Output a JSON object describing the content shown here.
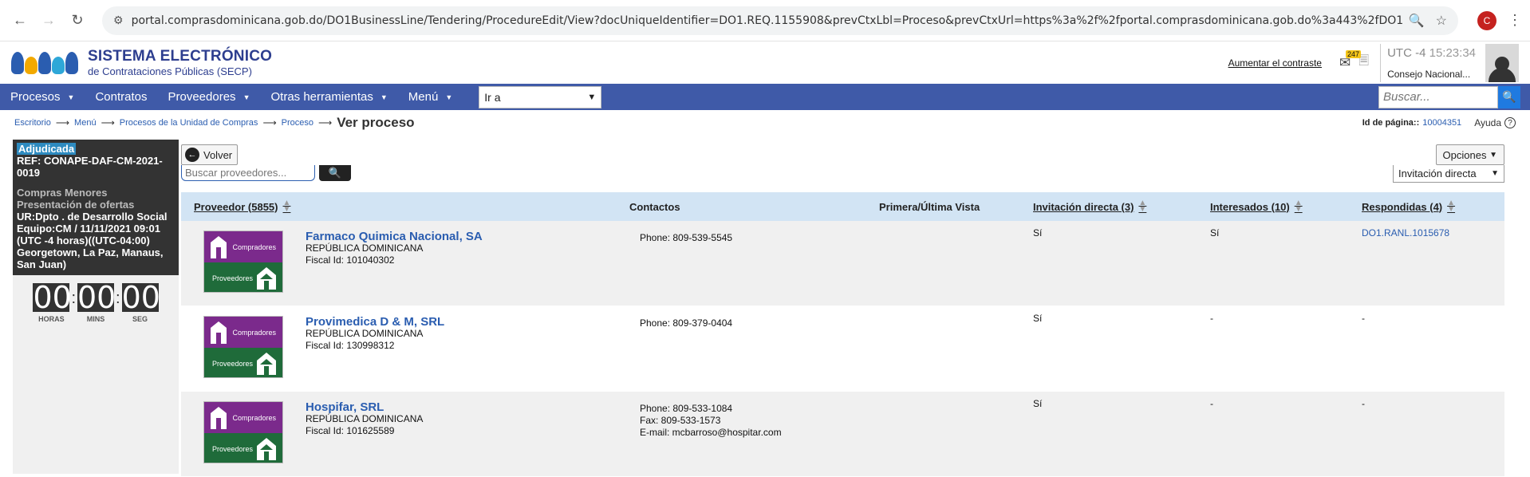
{
  "browser": {
    "url": "portal.comprasdominicana.gob.do/DO1BusinessLine/Tendering/ProcedureEdit/View?docUniqueIdentifier=DO1.REQ.1155908&prevCtxLbl=Proceso&prevCtxUrl=https%3a%2f%2fportal.comprasdominicana.gob.do%3a443%2fDO1BusinessLine%2fTendering%2f...",
    "profile_initial": "C"
  },
  "header": {
    "brand_title": "SISTEMA ELECTRÓNICO",
    "brand_sub": "de Contrataciones Públicas (SECP)",
    "contrast_link": "Aumentar el contraste",
    "mail_count": "247",
    "timezone": "UTC -4",
    "time": "15:23:34",
    "org": "Consejo Nacional..."
  },
  "nav": {
    "items": [
      "Procesos",
      "Contratos",
      "Proveedores",
      "Otras herramientas",
      "Menú"
    ],
    "goto_value": "Ir a",
    "search_placeholder": "Buscar..."
  },
  "breadcrumb": {
    "items": [
      "Escritorio",
      "Menú",
      "Procesos de la Unidad de Compras",
      "Proceso"
    ],
    "current": "Ver proceso",
    "page_id_label": "Id de página::",
    "page_id": "10004351",
    "help": "Ayuda"
  },
  "process": {
    "status": "Adjudicada",
    "ref": "REF: CONAPE-DAF-CM-2021-0019",
    "type": "Compras Menores",
    "phase": "Presentación de ofertas",
    "details": "UR:Dpto . de Desarrollo Social Equipo:CM / 11/11/2021 09:01 (UTC -4 horas)((UTC-04:00) Georgetown, La Paz, Manaus, San Juan)"
  },
  "timer": {
    "hours": "00",
    "mins": "00",
    "secs": "00",
    "hours_label": "HORAS",
    "mins_label": "MINS",
    "secs_label": "SEG"
  },
  "actions": {
    "back": "Volver",
    "options": "Opciones",
    "provider_search_placeholder": "Buscar proveedores...",
    "filter": "Invitación directa"
  },
  "table": {
    "headers": {
      "proveedor": "Proveedor (5855)",
      "contactos": "Contactos",
      "vista": "Primera/Última Vista",
      "invitacion": "Invitación directa (3)",
      "interesados": "Interesados (10)",
      "respondidas": "Respondidas (4)"
    },
    "logo_top": "Compradores",
    "logo_bottom": "Proveedores",
    "rows": [
      {
        "name": "Farmaco Quimica Nacional, SA",
        "country": "REPÚBLICA DOMINICANA",
        "fiscal": "Fiscal Id: 101040302",
        "contact1": "Phone: 809-539-5545",
        "contact2": "",
        "contact3": "",
        "invitacion": "Sí",
        "interesados": "Sí",
        "respondidas": "DO1.RANL.1015678"
      },
      {
        "name": "Provimedica D & M, SRL",
        "country": "REPÚBLICA DOMINICANA",
        "fiscal": "Fiscal Id: 130998312",
        "contact1": "Phone: 809-379-0404",
        "contact2": "",
        "contact3": "",
        "invitacion": "Sí",
        "interesados": "-",
        "respondidas": "-"
      },
      {
        "name": "Hospifar, SRL",
        "country": "REPÚBLICA DOMINICANA",
        "fiscal": "Fiscal Id: 101625589",
        "contact1": "Phone: 809-533-1084",
        "contact2": "Fax: 809-533-1573",
        "contact3": "E-mail: mcbarroso@hospitar.com",
        "invitacion": "Sí",
        "interesados": "-",
        "respondidas": "-"
      }
    ]
  }
}
